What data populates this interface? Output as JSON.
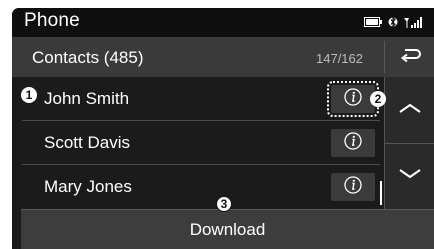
{
  "status_bar": {
    "title": "Phone",
    "icons": [
      "battery-icon",
      "bluetooth-icon",
      "signal-icon"
    ]
  },
  "header": {
    "title": "Contacts (485)",
    "count": "147/162",
    "back_icon": "back-arrow-icon"
  },
  "contacts": [
    {
      "name": "John Smith",
      "info_icon": "info-icon"
    },
    {
      "name": "Scott Davis",
      "info_icon": "info-icon"
    },
    {
      "name": "Mary Jones",
      "info_icon": "info-icon"
    }
  ],
  "scroll": {
    "up_icon": "chevron-up-icon",
    "down_icon": "chevron-down-icon"
  },
  "download_label": "Download",
  "callouts": [
    "1",
    "2",
    "3"
  ],
  "colors": {
    "background": "#1b1b1b",
    "header": "#3a3a3a",
    "button": "#3b3b3b",
    "text": "#ffffff"
  }
}
